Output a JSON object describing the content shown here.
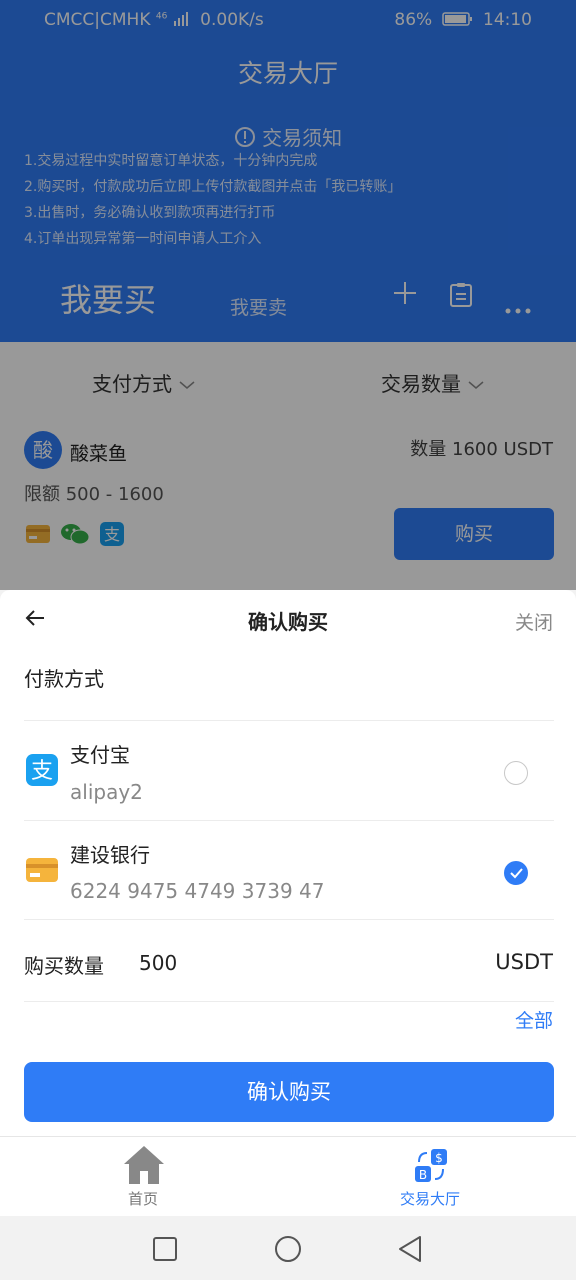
{
  "status_bar": {
    "carrier": "CMCC|CMHK",
    "network": "46",
    "speed": "0.00K/s",
    "battery": "86%",
    "time": "14:10"
  },
  "header": {
    "title": "交易大厅"
  },
  "notice": {
    "title": "交易须知",
    "lines": [
      "1.交易过程中实时留意订单状态，十分钟内完成",
      "2.购买时，付款成功后立即上传付款截图并点击「我已转账」",
      "3.出售时，务必确认收到款项再进行打币",
      "4.订单出现异常第一时间申请人工介入"
    ]
  },
  "tabs": {
    "buy": "我要买",
    "sell": "我要卖"
  },
  "filters": {
    "payment": "支付方式",
    "quantity": "交易数量"
  },
  "listing": {
    "avatar_char": "酸",
    "seller": "酸菜鱼",
    "quantity": "数量 1600 USDT",
    "limit": "限额 500 - 1600",
    "buy_label": "购买"
  },
  "sheet": {
    "title": "确认购买",
    "close_label": "关闭",
    "payment_label": "付款方式",
    "methods": [
      {
        "name": "支付宝",
        "detail": "alipay2",
        "selected": false
      },
      {
        "name": "建设银行",
        "detail": "6224 9475 4749 3739 47",
        "selected": true
      }
    ],
    "amount_label": "购买数量",
    "amount_value": "500",
    "unit": "USDT",
    "all_label": "全部",
    "confirm_label": "确认购买"
  },
  "bottom_nav": {
    "home": "首页",
    "market": "交易大厅"
  },
  "colors": {
    "primary": "#2f7cf6",
    "alipay": "#1aa1f0",
    "wechat": "#36b04a",
    "card": "#f5b43c"
  }
}
